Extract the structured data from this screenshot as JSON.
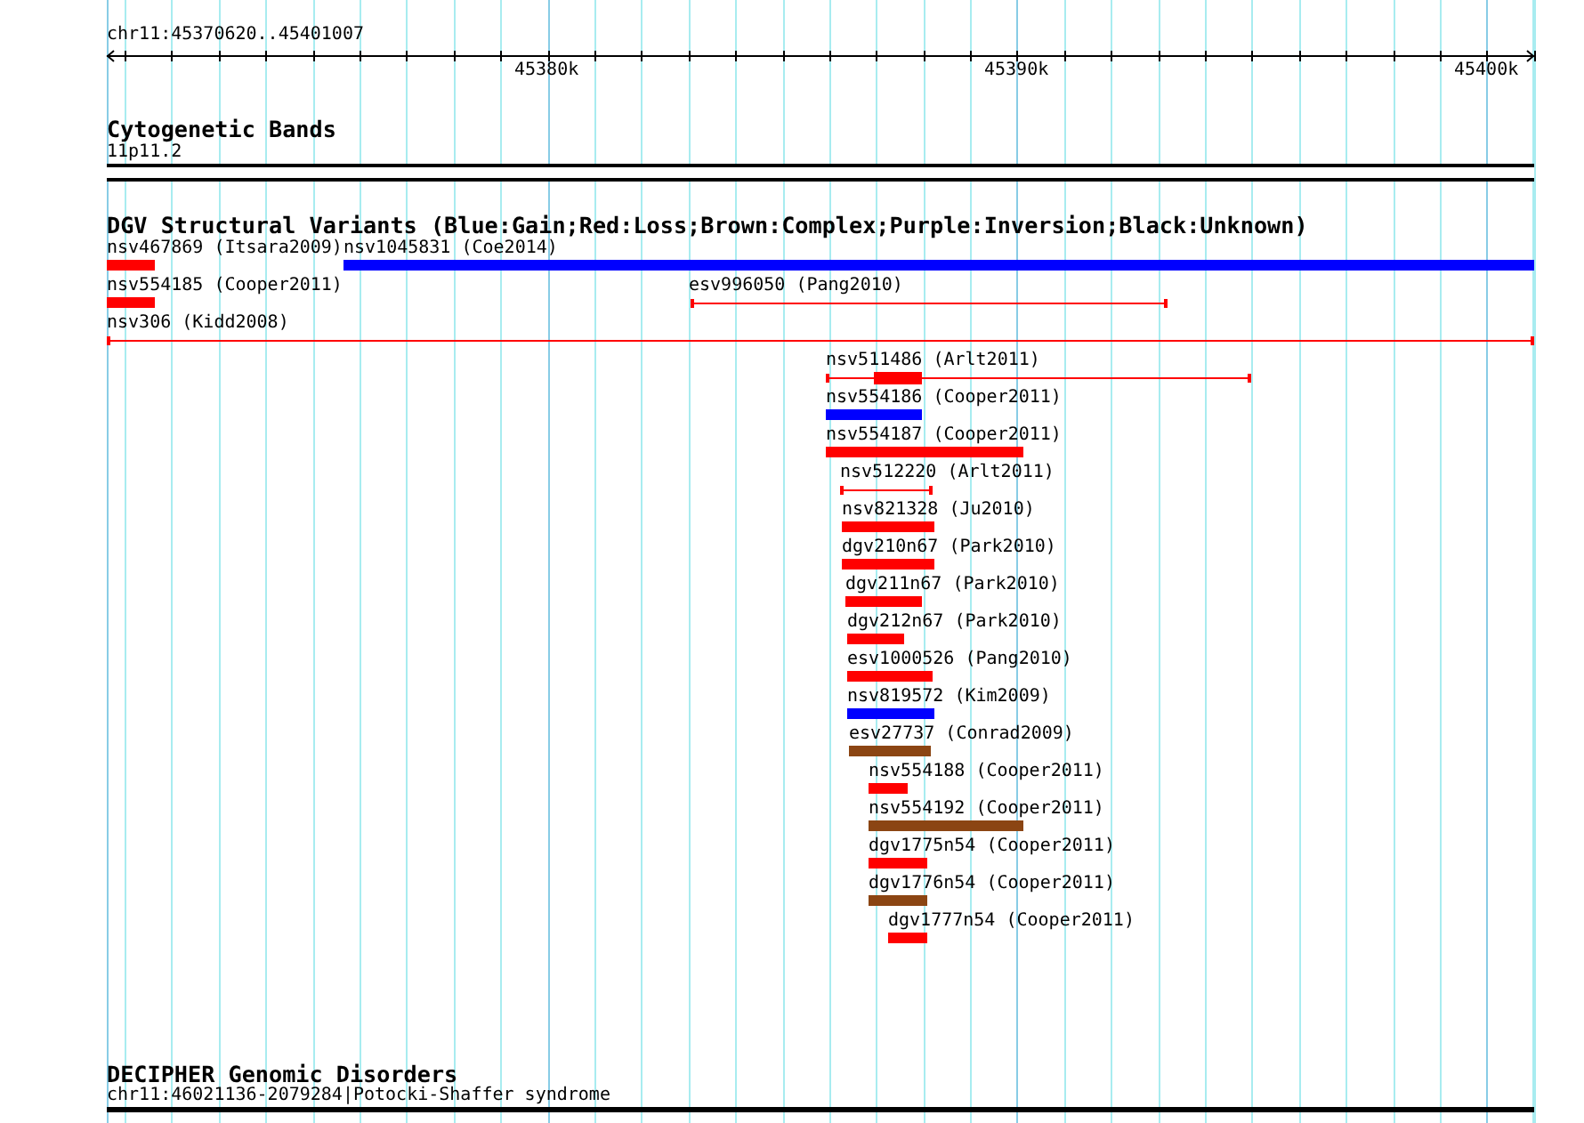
{
  "ruler": {
    "region": "chr11:45370620..45401007",
    "ticks": [
      "45380k",
      "45390k",
      "45400k"
    ]
  },
  "cytogenetic_bands": {
    "title": "Cytogenetic Bands",
    "band": "11p11.2"
  },
  "dgv": {
    "title": "DGV Structural Variants (Blue:Gain;Red:Loss;Brown:Complex;Purple:Inversion;Black:Unknown)",
    "rows": [
      [
        {
          "label": "nsv467869 (Itsara2009)",
          "kind": "bar",
          "color": "#ff0000"
        },
        {
          "label": "nsv1045831 (Coe2014)",
          "kind": "bar",
          "color": "#0000ff"
        }
      ],
      [
        {
          "label": "nsv554185 (Cooper2011)",
          "kind": "bar",
          "color": "#ff0000"
        },
        {
          "label": "esv996050 (Pang2010)",
          "kind": "range",
          "color": "#ff0000"
        }
      ],
      [
        {
          "label": "nsv306 (Kidd2008)",
          "kind": "range",
          "color": "#ff0000"
        }
      ],
      [
        {
          "label": "nsv511486 (Arlt2011)",
          "kind": "range_with_bar",
          "color": "#ff0000"
        }
      ],
      [
        {
          "label": "nsv554186 (Cooper2011)",
          "kind": "bar",
          "color": "#0000ff"
        }
      ],
      [
        {
          "label": "nsv554187 (Cooper2011)",
          "kind": "bar",
          "color": "#ff0000"
        }
      ],
      [
        {
          "label": "nsv512220 (Arlt2011)",
          "kind": "range",
          "color": "#ff0000"
        }
      ],
      [
        {
          "label": "nsv821328 (Ju2010)",
          "kind": "bar",
          "color": "#ff0000"
        }
      ],
      [
        {
          "label": "dgv210n67 (Park2010)",
          "kind": "bar",
          "color": "#ff0000"
        }
      ],
      [
        {
          "label": "dgv211n67 (Park2010)",
          "kind": "bar",
          "color": "#ff0000"
        }
      ],
      [
        {
          "label": "dgv212n67 (Park2010)",
          "kind": "bar",
          "color": "#ff0000"
        }
      ],
      [
        {
          "label": "esv1000526 (Pang2010)",
          "kind": "bar",
          "color": "#ff0000"
        }
      ],
      [
        {
          "label": "nsv819572 (Kim2009)",
          "kind": "bar",
          "color": "#0000ff"
        }
      ],
      [
        {
          "label": "esv27737 (Conrad2009)",
          "kind": "bar",
          "color": "#8b4513"
        }
      ],
      [
        {
          "label": "nsv554188 (Cooper2011)",
          "kind": "bar",
          "color": "#ff0000"
        }
      ],
      [
        {
          "label": "nsv554192 (Cooper2011)",
          "kind": "bar",
          "color": "#8b4513"
        }
      ],
      [
        {
          "label": "dgv1775n54 (Cooper2011)",
          "kind": "bar",
          "color": "#ff0000"
        }
      ],
      [
        {
          "label": "dgv1776n54 (Cooper2011)",
          "kind": "bar",
          "color": "#8b4513"
        }
      ],
      [
        {
          "label": "dgv1777n54 (Cooper2011)",
          "kind": "bar",
          "color": "#ff0000"
        }
      ]
    ]
  },
  "decipher": {
    "title": "DECIPHER Genomic Disorders",
    "entry": "chr11:46021136-2079284|Potocki-Shaffer syndrome"
  }
}
